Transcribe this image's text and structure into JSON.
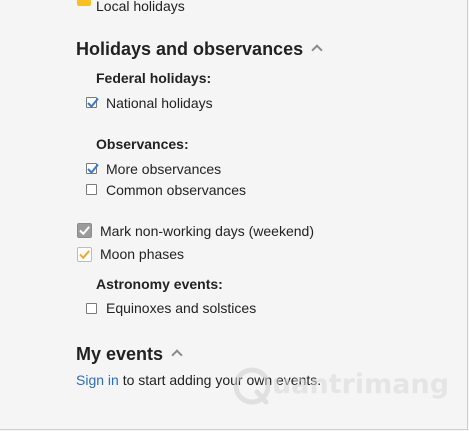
{
  "calendars": {
    "local_holidays": {
      "label": "Local holidays",
      "color": "#f6c026"
    }
  },
  "holidays_section": {
    "title": "Holidays and observances",
    "federal": {
      "heading": "Federal holidays:",
      "items": [
        {
          "label": "National holidays",
          "checked": true
        }
      ]
    },
    "observances": {
      "heading": "Observances:",
      "items": [
        {
          "label": "More observances",
          "checked": true
        },
        {
          "label": "Common observances",
          "checked": false
        }
      ]
    },
    "mark_nonworking": {
      "label": "Mark non-working days (weekend)",
      "checked": true
    },
    "moon_phases": {
      "label": "Moon phases",
      "checked": true
    },
    "astronomy": {
      "heading": "Astronomy events:",
      "items": [
        {
          "label": "Equinoxes and solstices",
          "checked": false
        }
      ]
    }
  },
  "my_events": {
    "title": "My events",
    "signin_link": "Sign in",
    "signin_rest": " to start adding your own events."
  },
  "watermark": {
    "text": "uantrimang"
  },
  "colors": {
    "accent": "#2a6ebb",
    "check_blue": "#3a78c9",
    "moon_check": "#f0a830",
    "gray_box": "#9b9b9b"
  }
}
